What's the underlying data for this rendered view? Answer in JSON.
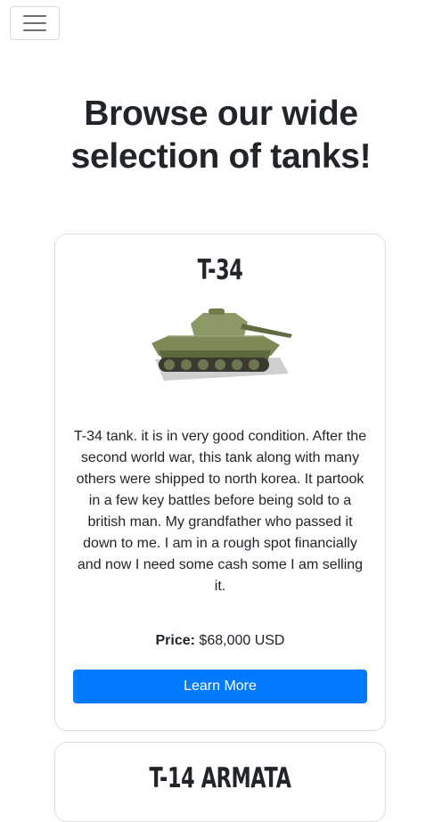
{
  "navbar": {
    "toggle_icon": "hamburger-menu-icon"
  },
  "heading": {
    "line1": "Browse our wide",
    "line2": "selection of tanks!"
  },
  "colors": {
    "primary": "#007bff",
    "text": "#212529",
    "tank_green": "#7a8a55"
  },
  "tanks": [
    {
      "name": "T-34",
      "image_icon": "t34-tank-image",
      "description": "T-34 tank. it is in very good condition. After the second world war, this tank along with many others were shipped to north korea. It partook in a few key battles before being sold to a british man. My grandfather who passed it down to me. I am in a rough spot financially and now I need some cash some I am selling it.",
      "price_label": "Price:",
      "price_value": "$68,000 USD",
      "button_label": "Learn More"
    },
    {
      "name": "T-14 ARMATA"
    }
  ]
}
